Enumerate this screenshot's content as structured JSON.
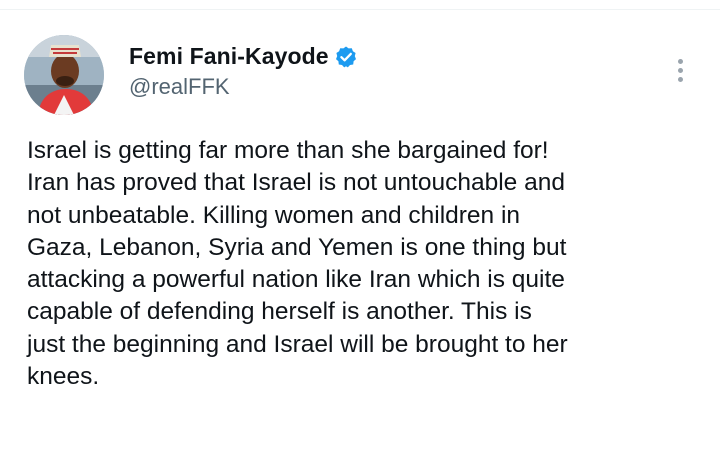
{
  "author": {
    "display_name": "Femi Fani-Kayode",
    "handle": "@realFFK",
    "verified": true,
    "verified_color": "#1d9bf0"
  },
  "tweet": {
    "text": "Israel is getting far more than she bargained for!\nIran has proved that Israel is not untouchable and\nnot unbeatable. Killing women and children in\nGaza, Lebanon, Syria and Yemen is one thing but\nattacking a powerful nation like Iran which is quite\ncapable of defending herself is another. This is\njust the beginning and Israel will be brought to her\nknees."
  },
  "icons": {
    "verified": "verified-badge-icon",
    "more": "more-options-icon"
  }
}
